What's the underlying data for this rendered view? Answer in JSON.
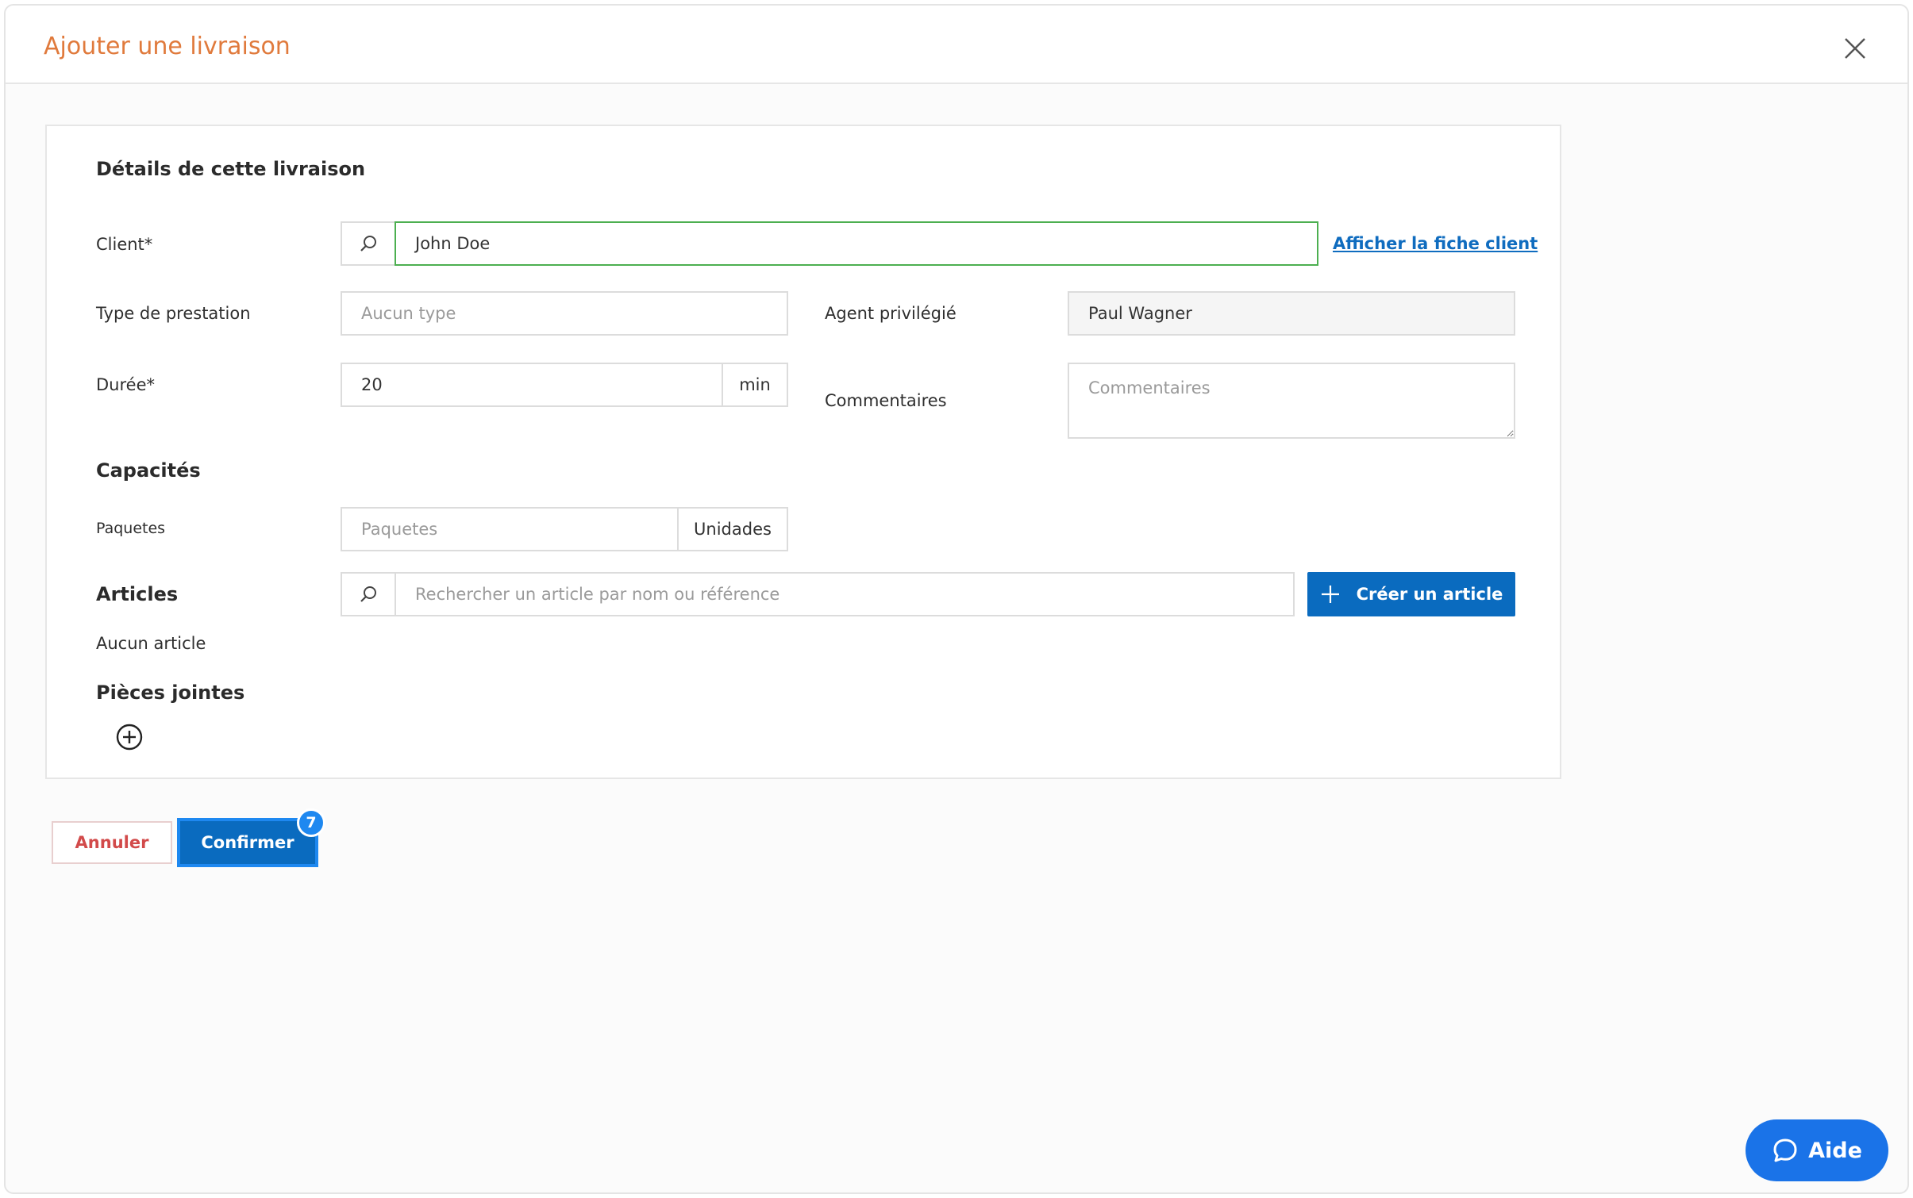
{
  "header": {
    "title": "Ajouter une livraison"
  },
  "details": {
    "section_title": "Détails de cette livraison",
    "client_label": "Client*",
    "client_value": "John Doe",
    "client_link": "Afficher la fiche client",
    "type_label": "Type de prestation",
    "type_placeholder": "Aucun type",
    "agent_label": "Agent privilégié",
    "agent_value": "Paul Wagner",
    "duration_label": "Durée*",
    "duration_value": "20",
    "duration_unit": "min",
    "comments_label": "Commentaires",
    "comments_placeholder": "Commentaires"
  },
  "capacities": {
    "section_title": "Capacités",
    "packages_label": "Paquetes",
    "packages_placeholder": "Paquetes",
    "packages_unit": "Unidades"
  },
  "articles": {
    "section_title": "Articles",
    "search_placeholder": "Rechercher un article par nom ou référence",
    "create_label": "Créer un article",
    "empty_text": "Aucun article"
  },
  "attachments": {
    "section_title": "Pièces jointes"
  },
  "footer": {
    "cancel_label": "Annuler",
    "confirm_label": "Confirmer",
    "badge_count": "7"
  },
  "help": {
    "label": "Aide"
  },
  "colors": {
    "accent": "#0a6bbf",
    "title_orange": "#e07a3c",
    "cancel_red": "#d24a4a",
    "focus_green": "#4caf50"
  }
}
